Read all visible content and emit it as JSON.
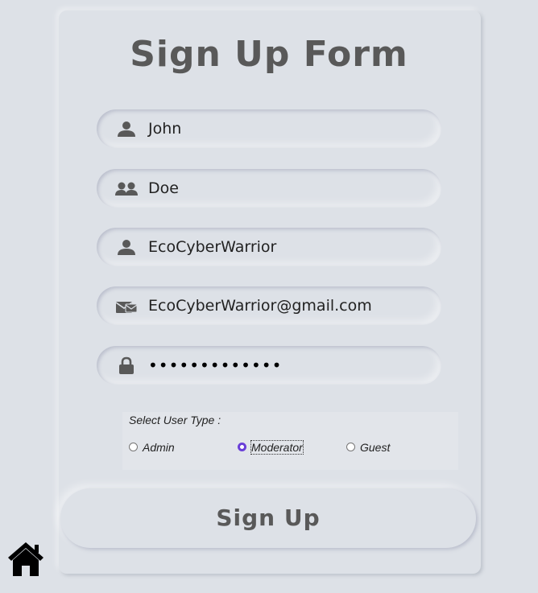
{
  "form": {
    "title": "Sign Up Form",
    "fields": [
      {
        "name": "first-name",
        "icon": "user-icon",
        "value": "John"
      },
      {
        "name": "last-name",
        "icon": "users-icon",
        "value": "Doe"
      },
      {
        "name": "username",
        "icon": "user-icon",
        "value": "EcoCyberWarrior"
      },
      {
        "name": "email",
        "icon": "envelope-icon",
        "value": "EcoCyberWarrior@gmail.com"
      },
      {
        "name": "password",
        "icon": "lock-icon",
        "value": "•••••••••••••"
      }
    ],
    "user_type": {
      "label": "Select User Type :",
      "options": [
        "Admin",
        "Moderator",
        "Guest"
      ],
      "selected": "Moderator"
    },
    "submit_label": "Sign Up"
  },
  "nav": {
    "home_icon": "home-icon"
  },
  "colors": {
    "background": "#dde1e7",
    "title": "#595959",
    "radio_checked": "#6a3fd8"
  }
}
